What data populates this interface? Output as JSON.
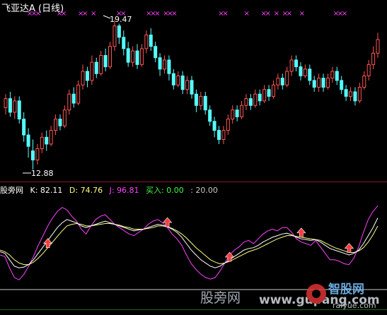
{
  "title": "飞亚达A (日线)",
  "price": {
    "high_label": "19.47",
    "low_label": "12.88",
    "high_value": 19.47,
    "low_value": 12.88,
    "candles": [
      {
        "o": 15.6,
        "c": 16.0,
        "h": 16.2,
        "l": 15.3
      },
      {
        "o": 16.0,
        "c": 15.4,
        "h": 16.3,
        "l": 15.2
      },
      {
        "o": 15.4,
        "c": 15.9,
        "h": 16.1,
        "l": 15.1
      },
      {
        "o": 15.9,
        "c": 15.1,
        "h": 16.1,
        "l": 14.9
      },
      {
        "o": 15.1,
        "c": 14.4,
        "h": 15.4,
        "l": 14.1
      },
      {
        "o": 14.4,
        "c": 13.9,
        "h": 14.7,
        "l": 13.4
      },
      {
        "o": 13.7,
        "c": 13.3,
        "h": 14.2,
        "l": 12.88
      },
      {
        "o": 13.3,
        "c": 13.8,
        "h": 14.0,
        "l": 13.1
      },
      {
        "o": 13.8,
        "c": 14.3,
        "h": 14.5,
        "l": 13.6
      },
      {
        "o": 14.3,
        "c": 14.0,
        "h": 14.6,
        "l": 13.7
      },
      {
        "o": 14.0,
        "c": 14.6,
        "h": 14.8,
        "l": 13.9
      },
      {
        "o": 14.6,
        "c": 15.1,
        "h": 15.3,
        "l": 14.4
      },
      {
        "o": 15.1,
        "c": 14.8,
        "h": 15.3,
        "l": 14.6
      },
      {
        "o": 14.8,
        "c": 15.5,
        "h": 15.7,
        "l": 14.7
      },
      {
        "o": 15.5,
        "c": 16.2,
        "h": 16.4,
        "l": 15.3
      },
      {
        "o": 16.2,
        "c": 15.8,
        "h": 16.5,
        "l": 15.6
      },
      {
        "o": 15.8,
        "c": 16.6,
        "h": 16.8,
        "l": 15.7
      },
      {
        "o": 16.6,
        "c": 17.2,
        "h": 17.5,
        "l": 16.4
      },
      {
        "o": 17.2,
        "c": 16.8,
        "h": 17.4,
        "l": 16.5
      },
      {
        "o": 16.8,
        "c": 17.6,
        "h": 17.9,
        "l": 16.6
      },
      {
        "o": 17.6,
        "c": 17.1,
        "h": 17.8,
        "l": 16.9
      },
      {
        "o": 17.1,
        "c": 17.9,
        "h": 18.1,
        "l": 17.0
      },
      {
        "o": 17.9,
        "c": 17.4,
        "h": 18.2,
        "l": 17.2
      },
      {
        "o": 17.4,
        "c": 18.3,
        "h": 18.5,
        "l": 17.3
      },
      {
        "o": 18.3,
        "c": 19.2,
        "h": 19.47,
        "l": 18.1
      },
      {
        "o": 19.2,
        "c": 18.7,
        "h": 19.3,
        "l": 18.4
      },
      {
        "o": 18.7,
        "c": 18.2,
        "h": 19.0,
        "l": 17.9
      },
      {
        "o": 18.2,
        "c": 17.6,
        "h": 18.5,
        "l": 17.4
      },
      {
        "o": 17.6,
        "c": 18.1,
        "h": 18.3,
        "l": 17.4
      },
      {
        "o": 18.1,
        "c": 17.5,
        "h": 18.4,
        "l": 17.3
      },
      {
        "o": 17.5,
        "c": 18.2,
        "h": 18.4,
        "l": 17.4
      },
      {
        "o": 18.2,
        "c": 18.8,
        "h": 19.0,
        "l": 18.0
      },
      {
        "o": 18.8,
        "c": 18.3,
        "h": 19.1,
        "l": 18.1
      },
      {
        "o": 18.3,
        "c": 17.8,
        "h": 18.5,
        "l": 17.6
      },
      {
        "o": 17.8,
        "c": 17.3,
        "h": 18.0,
        "l": 17.0
      },
      {
        "o": 17.3,
        "c": 17.7,
        "h": 17.9,
        "l": 17.1
      },
      {
        "o": 17.7,
        "c": 17.1,
        "h": 17.9,
        "l": 16.8
      },
      {
        "o": 17.1,
        "c": 16.6,
        "h": 17.3,
        "l": 16.4
      },
      {
        "o": 16.6,
        "c": 17.0,
        "h": 17.2,
        "l": 16.5
      },
      {
        "o": 17.0,
        "c": 16.4,
        "h": 17.2,
        "l": 16.2
      },
      {
        "o": 16.4,
        "c": 16.8,
        "h": 17.0,
        "l": 16.2
      },
      {
        "o": 16.8,
        "c": 16.2,
        "h": 17.0,
        "l": 16.0
      },
      {
        "o": 16.2,
        "c": 15.7,
        "h": 16.4,
        "l": 15.4
      },
      {
        "o": 15.7,
        "c": 16.1,
        "h": 16.3,
        "l": 15.5
      },
      {
        "o": 16.1,
        "c": 15.5,
        "h": 16.3,
        "l": 15.3
      },
      {
        "o": 15.5,
        "c": 15.0,
        "h": 15.7,
        "l": 14.8
      },
      {
        "o": 15.0,
        "c": 14.6,
        "h": 15.2,
        "l": 14.3
      },
      {
        "o": 14.6,
        "c": 14.2,
        "h": 14.8,
        "l": 14.0
      },
      {
        "o": 14.2,
        "c": 14.6,
        "h": 14.8,
        "l": 14.0
      },
      {
        "o": 14.6,
        "c": 15.1,
        "h": 15.3,
        "l": 14.4
      },
      {
        "o": 15.1,
        "c": 15.5,
        "h": 15.7,
        "l": 14.9
      },
      {
        "o": 15.5,
        "c": 15.2,
        "h": 15.7,
        "l": 15.0
      },
      {
        "o": 15.2,
        "c": 15.7,
        "h": 15.9,
        "l": 15.1
      },
      {
        "o": 15.7,
        "c": 16.0,
        "h": 16.2,
        "l": 15.5
      },
      {
        "o": 16.0,
        "c": 15.7,
        "h": 16.2,
        "l": 15.5
      },
      {
        "o": 15.7,
        "c": 16.2,
        "h": 16.4,
        "l": 15.6
      },
      {
        "o": 16.2,
        "c": 15.9,
        "h": 16.4,
        "l": 15.7
      },
      {
        "o": 15.9,
        "c": 16.4,
        "h": 16.6,
        "l": 15.8
      },
      {
        "o": 16.4,
        "c": 16.1,
        "h": 16.6,
        "l": 15.9
      },
      {
        "o": 16.1,
        "c": 16.6,
        "h": 16.8,
        "l": 16.0
      },
      {
        "o": 16.6,
        "c": 16.9,
        "h": 17.1,
        "l": 16.4
      },
      {
        "o": 16.9,
        "c": 16.6,
        "h": 17.1,
        "l": 16.4
      },
      {
        "o": 16.6,
        "c": 17.2,
        "h": 17.4,
        "l": 16.5
      },
      {
        "o": 17.2,
        "c": 17.7,
        "h": 17.9,
        "l": 17.0
      },
      {
        "o": 17.7,
        "c": 17.4,
        "h": 17.9,
        "l": 17.2
      },
      {
        "o": 17.4,
        "c": 17.0,
        "h": 17.6,
        "l": 16.8
      },
      {
        "o": 17.0,
        "c": 17.3,
        "h": 17.5,
        "l": 16.9
      },
      {
        "o": 17.3,
        "c": 16.8,
        "h": 17.5,
        "l": 16.6
      },
      {
        "o": 16.8,
        "c": 16.5,
        "h": 17.0,
        "l": 16.3
      },
      {
        "o": 16.5,
        "c": 16.9,
        "h": 17.1,
        "l": 16.3
      },
      {
        "o": 16.9,
        "c": 16.5,
        "h": 17.1,
        "l": 16.3
      },
      {
        "o": 16.5,
        "c": 16.9,
        "h": 17.1,
        "l": 16.4
      },
      {
        "o": 16.9,
        "c": 17.2,
        "h": 17.4,
        "l": 16.7
      },
      {
        "o": 17.2,
        "c": 16.8,
        "h": 17.4,
        "l": 16.6
      },
      {
        "o": 16.8,
        "c": 16.4,
        "h": 17.0,
        "l": 16.2
      },
      {
        "o": 16.4,
        "c": 16.1,
        "h": 16.6,
        "l": 15.9
      },
      {
        "o": 16.1,
        "c": 16.3,
        "h": 16.5,
        "l": 15.9
      },
      {
        "o": 16.3,
        "c": 15.9,
        "h": 16.5,
        "l": 15.7
      },
      {
        "o": 15.9,
        "c": 16.5,
        "h": 16.7,
        "l": 15.8
      },
      {
        "o": 16.5,
        "c": 17.0,
        "h": 17.2,
        "l": 16.4
      },
      {
        "o": 17.0,
        "c": 17.5,
        "h": 17.7,
        "l": 16.8
      },
      {
        "o": 17.5,
        "c": 18.0,
        "h": 18.3,
        "l": 17.3
      },
      {
        "o": 18.0,
        "c": 18.6,
        "h": 18.9,
        "l": 17.8
      }
    ],
    "sell_marks_idx": [
      2,
      3,
      4,
      9,
      10,
      14,
      15,
      17,
      23,
      24,
      30,
      31,
      32,
      34,
      35,
      36,
      47,
      48,
      53,
      57,
      58,
      60,
      62,
      63,
      66,
      74,
      75,
      76
    ]
  },
  "indicator": {
    "name": "股旁网",
    "k_label": "K: 82.11",
    "d_label": "D: 74.76",
    "j_label": "J: 96.81",
    "buy_label": "买入: 0.00",
    "level_label": ": 20.00",
    "level_value": 20,
    "k_values": [
      40,
      38,
      30,
      22,
      20,
      21,
      24,
      30,
      38,
      46,
      54,
      62,
      70,
      76,
      80,
      78,
      76,
      72,
      70,
      72,
      74,
      76,
      78,
      76,
      74,
      72,
      70,
      68,
      66,
      67,
      68,
      70,
      72,
      74,
      73,
      71,
      68,
      64,
      58,
      50,
      42,
      36,
      30,
      26,
      22,
      20,
      22,
      26,
      30,
      34,
      38,
      42,
      44,
      45,
      48,
      52,
      55,
      58,
      60,
      62,
      63,
      61,
      58,
      56,
      55,
      54,
      55,
      52,
      48,
      44,
      42,
      40,
      38,
      36,
      38,
      42,
      50,
      60,
      70,
      82
    ],
    "d_values": [
      42,
      40,
      36,
      30,
      26,
      24,
      24,
      27,
      32,
      38,
      45,
      52,
      59,
      66,
      72,
      74,
      75,
      74,
      72,
      72,
      73,
      74,
      75,
      75,
      74,
      73,
      71,
      70,
      68,
      68,
      68,
      69,
      70,
      72,
      72,
      71,
      69,
      66,
      62,
      57,
      51,
      45,
      40,
      35,
      30,
      27,
      25,
      26,
      28,
      31,
      34,
      37,
      40,
      42,
      44,
      47,
      50,
      53,
      56,
      58,
      60,
      60,
      59,
      58,
      57,
      56,
      55,
      54,
      51,
      48,
      45,
      43,
      41,
      39,
      39,
      41,
      45,
      52,
      61,
      72
    ],
    "j_values": [
      36,
      34,
      20,
      8,
      5,
      12,
      22,
      34,
      48,
      60,
      72,
      82,
      90,
      95,
      92,
      84,
      78,
      68,
      62,
      72,
      80,
      84,
      86,
      80,
      74,
      70,
      66,
      62,
      60,
      64,
      68,
      74,
      78,
      80,
      76,
      70,
      62,
      56,
      48,
      36,
      25,
      18,
      12,
      8,
      6,
      8,
      16,
      26,
      36,
      42,
      46,
      52,
      54,
      50,
      56,
      62,
      66,
      68,
      66,
      70,
      70,
      64,
      56,
      52,
      50,
      48,
      54,
      46,
      38,
      30,
      30,
      28,
      25,
      24,
      32,
      46,
      64,
      80,
      90,
      97
    ],
    "arrow_idx": [
      10,
      35,
      48,
      63,
      73
    ]
  },
  "colors": {
    "up": "#ff5454",
    "down": "#54ffff",
    "k_line": "#ffffff",
    "d_line": "#ffff80",
    "j_line": "#ff40ff",
    "level": "#c8c8c8",
    "buy": "#40ff40",
    "separator": "#8a1a2a",
    "sell_mark": "#ff40ff",
    "arrow": "#ff3b3b"
  },
  "watermark": {
    "left_text": "股旁网",
    "url_text": "www.gupang.com",
    "logo_text": "智股网",
    "sub_text": "ralyue.com"
  }
}
